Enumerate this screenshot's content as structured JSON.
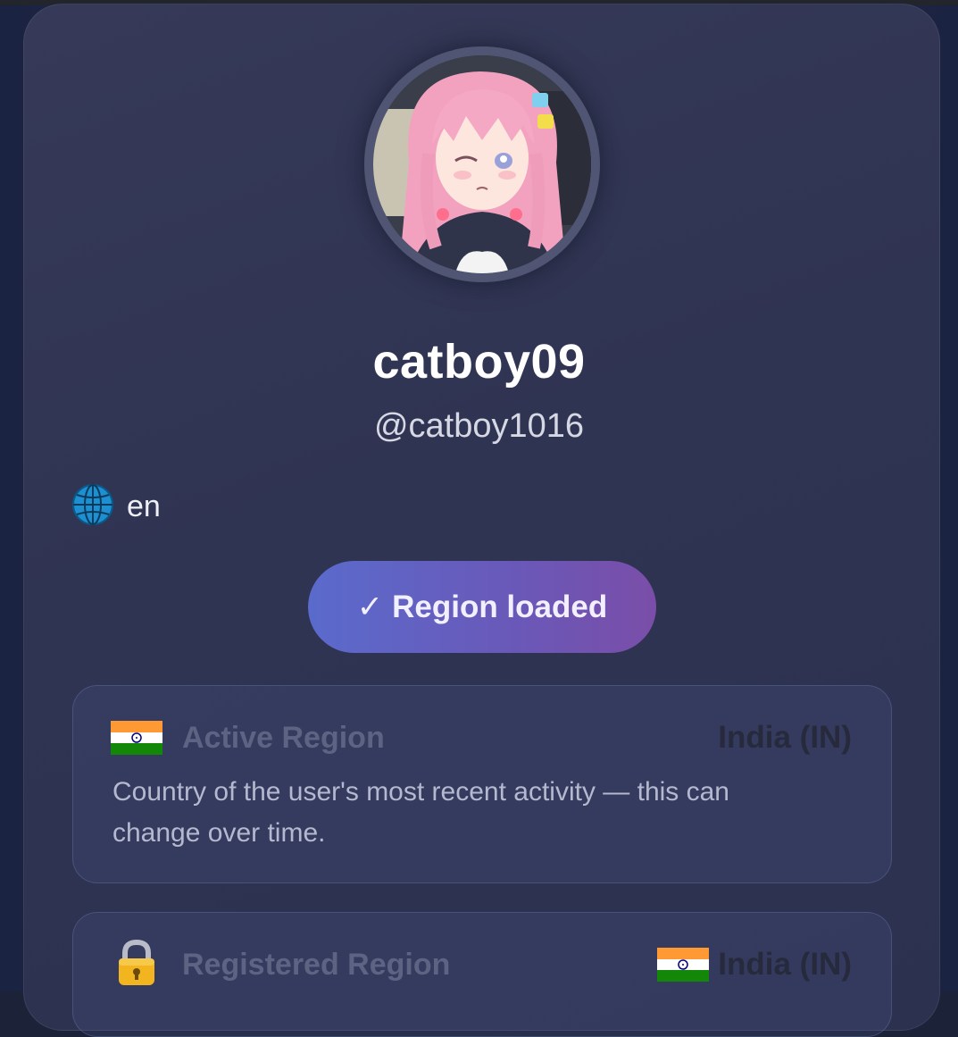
{
  "profile": {
    "display_name": "catboy09",
    "handle": "@catboy1016",
    "avatar_icon": "anime-avatar-pink-hair"
  },
  "language": {
    "icon": "globe-icon",
    "code": "en"
  },
  "status": {
    "icon": "check-mark",
    "label": "Region loaded",
    "check": "✓"
  },
  "regions": {
    "active": {
      "icon": "india-flag-icon",
      "label": "Active Region",
      "value": "India (IN)",
      "description": "Country of the user's most recent activity — this can change over time."
    },
    "registered": {
      "icon": "lock-icon",
      "label": "Registered Region",
      "value_icon": "india-flag-icon",
      "value": "India (IN)"
    }
  },
  "colors": {
    "card_bg": "#333855",
    "pill_start": "#5a6bcc",
    "pill_end": "#7a4ea8",
    "flag_saffron": "#ff9933",
    "flag_green": "#138808",
    "flag_chakra": "#000080"
  }
}
